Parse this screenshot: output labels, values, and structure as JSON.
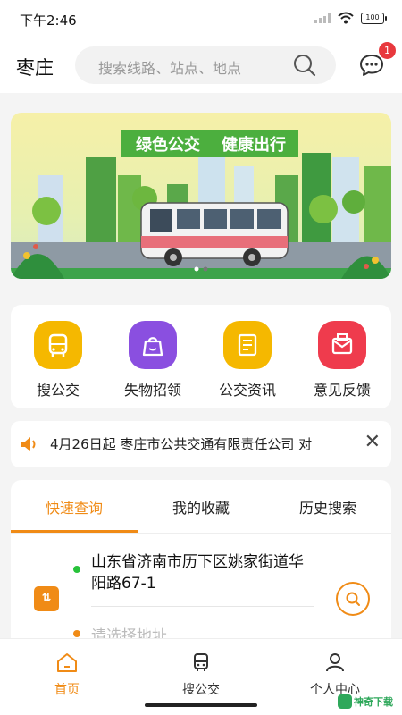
{
  "status_bar": {
    "time": "下午2:46",
    "battery": "100"
  },
  "header": {
    "city": "枣庄",
    "search_placeholder": "搜索线路、站点、地点",
    "message_badge": "1"
  },
  "banner": {
    "headline_left": "绿色公交",
    "headline_right": "健康出行",
    "page_count": 2,
    "active_page": 1
  },
  "services": [
    {
      "label": "搜公交",
      "icon": "bus-search-icon",
      "color": "#f5b800"
    },
    {
      "label": "失物招领",
      "icon": "lost-bag-icon",
      "color": "#8a4fe0"
    },
    {
      "label": "公交资讯",
      "icon": "news-doc-icon",
      "color": "#f5b800"
    },
    {
      "label": "意见反馈",
      "icon": "feedback-mail-icon",
      "color": "#ef3b4d"
    }
  ],
  "notice": {
    "text": "4月26日起 枣庄市公共交通有限责任公司 对"
  },
  "query": {
    "tabs": [
      "快速查询",
      "我的收藏",
      "历史搜索"
    ],
    "active_tab": 0,
    "from": "山东省济南市历下区姚家街道华阳路67-1",
    "to": "请选择地址"
  },
  "nav": [
    {
      "label": "首页",
      "icon": "home-icon"
    },
    {
      "label": "搜公交",
      "icon": "bus-icon"
    },
    {
      "label": "个人中心",
      "icon": "person-icon"
    }
  ],
  "watermark": "神奇下载",
  "colors": {
    "accent": "#f08b16",
    "badge": "#e8383d",
    "start_dot": "#27c23a"
  }
}
